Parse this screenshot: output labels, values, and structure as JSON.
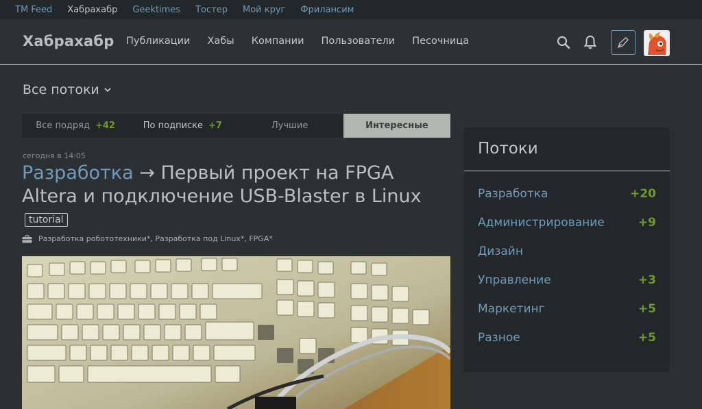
{
  "top_links": [
    {
      "label": "TM Feed",
      "active": false
    },
    {
      "label": "Хабрахабр",
      "active": true
    },
    {
      "label": "Geektimes",
      "active": false
    },
    {
      "label": "Тостер",
      "active": false
    },
    {
      "label": "Мой круг",
      "active": false
    },
    {
      "label": "Фрилансим",
      "active": false
    }
  ],
  "header": {
    "logo": "Хабрахабр",
    "nav": [
      "Публикации",
      "Хабы",
      "Компании",
      "Пользователи",
      "Песочница"
    ],
    "icons": [
      "search-icon",
      "bell-icon",
      "pen-icon",
      "avatar"
    ]
  },
  "flows": {
    "title": "Все потоки"
  },
  "tabs": [
    {
      "label": "Все подряд",
      "count": "+42",
      "active": false
    },
    {
      "label": "По подписке",
      "count": "+7",
      "active": false
    },
    {
      "label": "Лучшие",
      "count": "",
      "active": false
    },
    {
      "label": "Интересные",
      "count": "",
      "active": true
    }
  ],
  "post": {
    "time": "сегодня в 14:05",
    "hub": "Разработка",
    "arrow": "→",
    "title": "Первый проект на FPGA Altera и подключение USB-Blaster в Linux",
    "tag": "tutorial",
    "hubs": "Разработка робототехники*, Разработка под Linux*, FPGA*"
  },
  "sidebar": {
    "title": "Потоки",
    "items": [
      {
        "name": "Разработка",
        "value": "+20"
      },
      {
        "name": "Администрирование",
        "value": "+9"
      },
      {
        "name": "Дизайн",
        "value": ""
      },
      {
        "name": "Управление",
        "value": "+3"
      },
      {
        "name": "Маркетинг",
        "value": "+5"
      },
      {
        "name": "Разное",
        "value": "+5"
      }
    ]
  },
  "colors": {
    "background": "#2c3033",
    "panel": "#23272a",
    "link": "#6e9cbd",
    "positive": "#6c9c2e",
    "active_tab": "#b2b5b0"
  }
}
